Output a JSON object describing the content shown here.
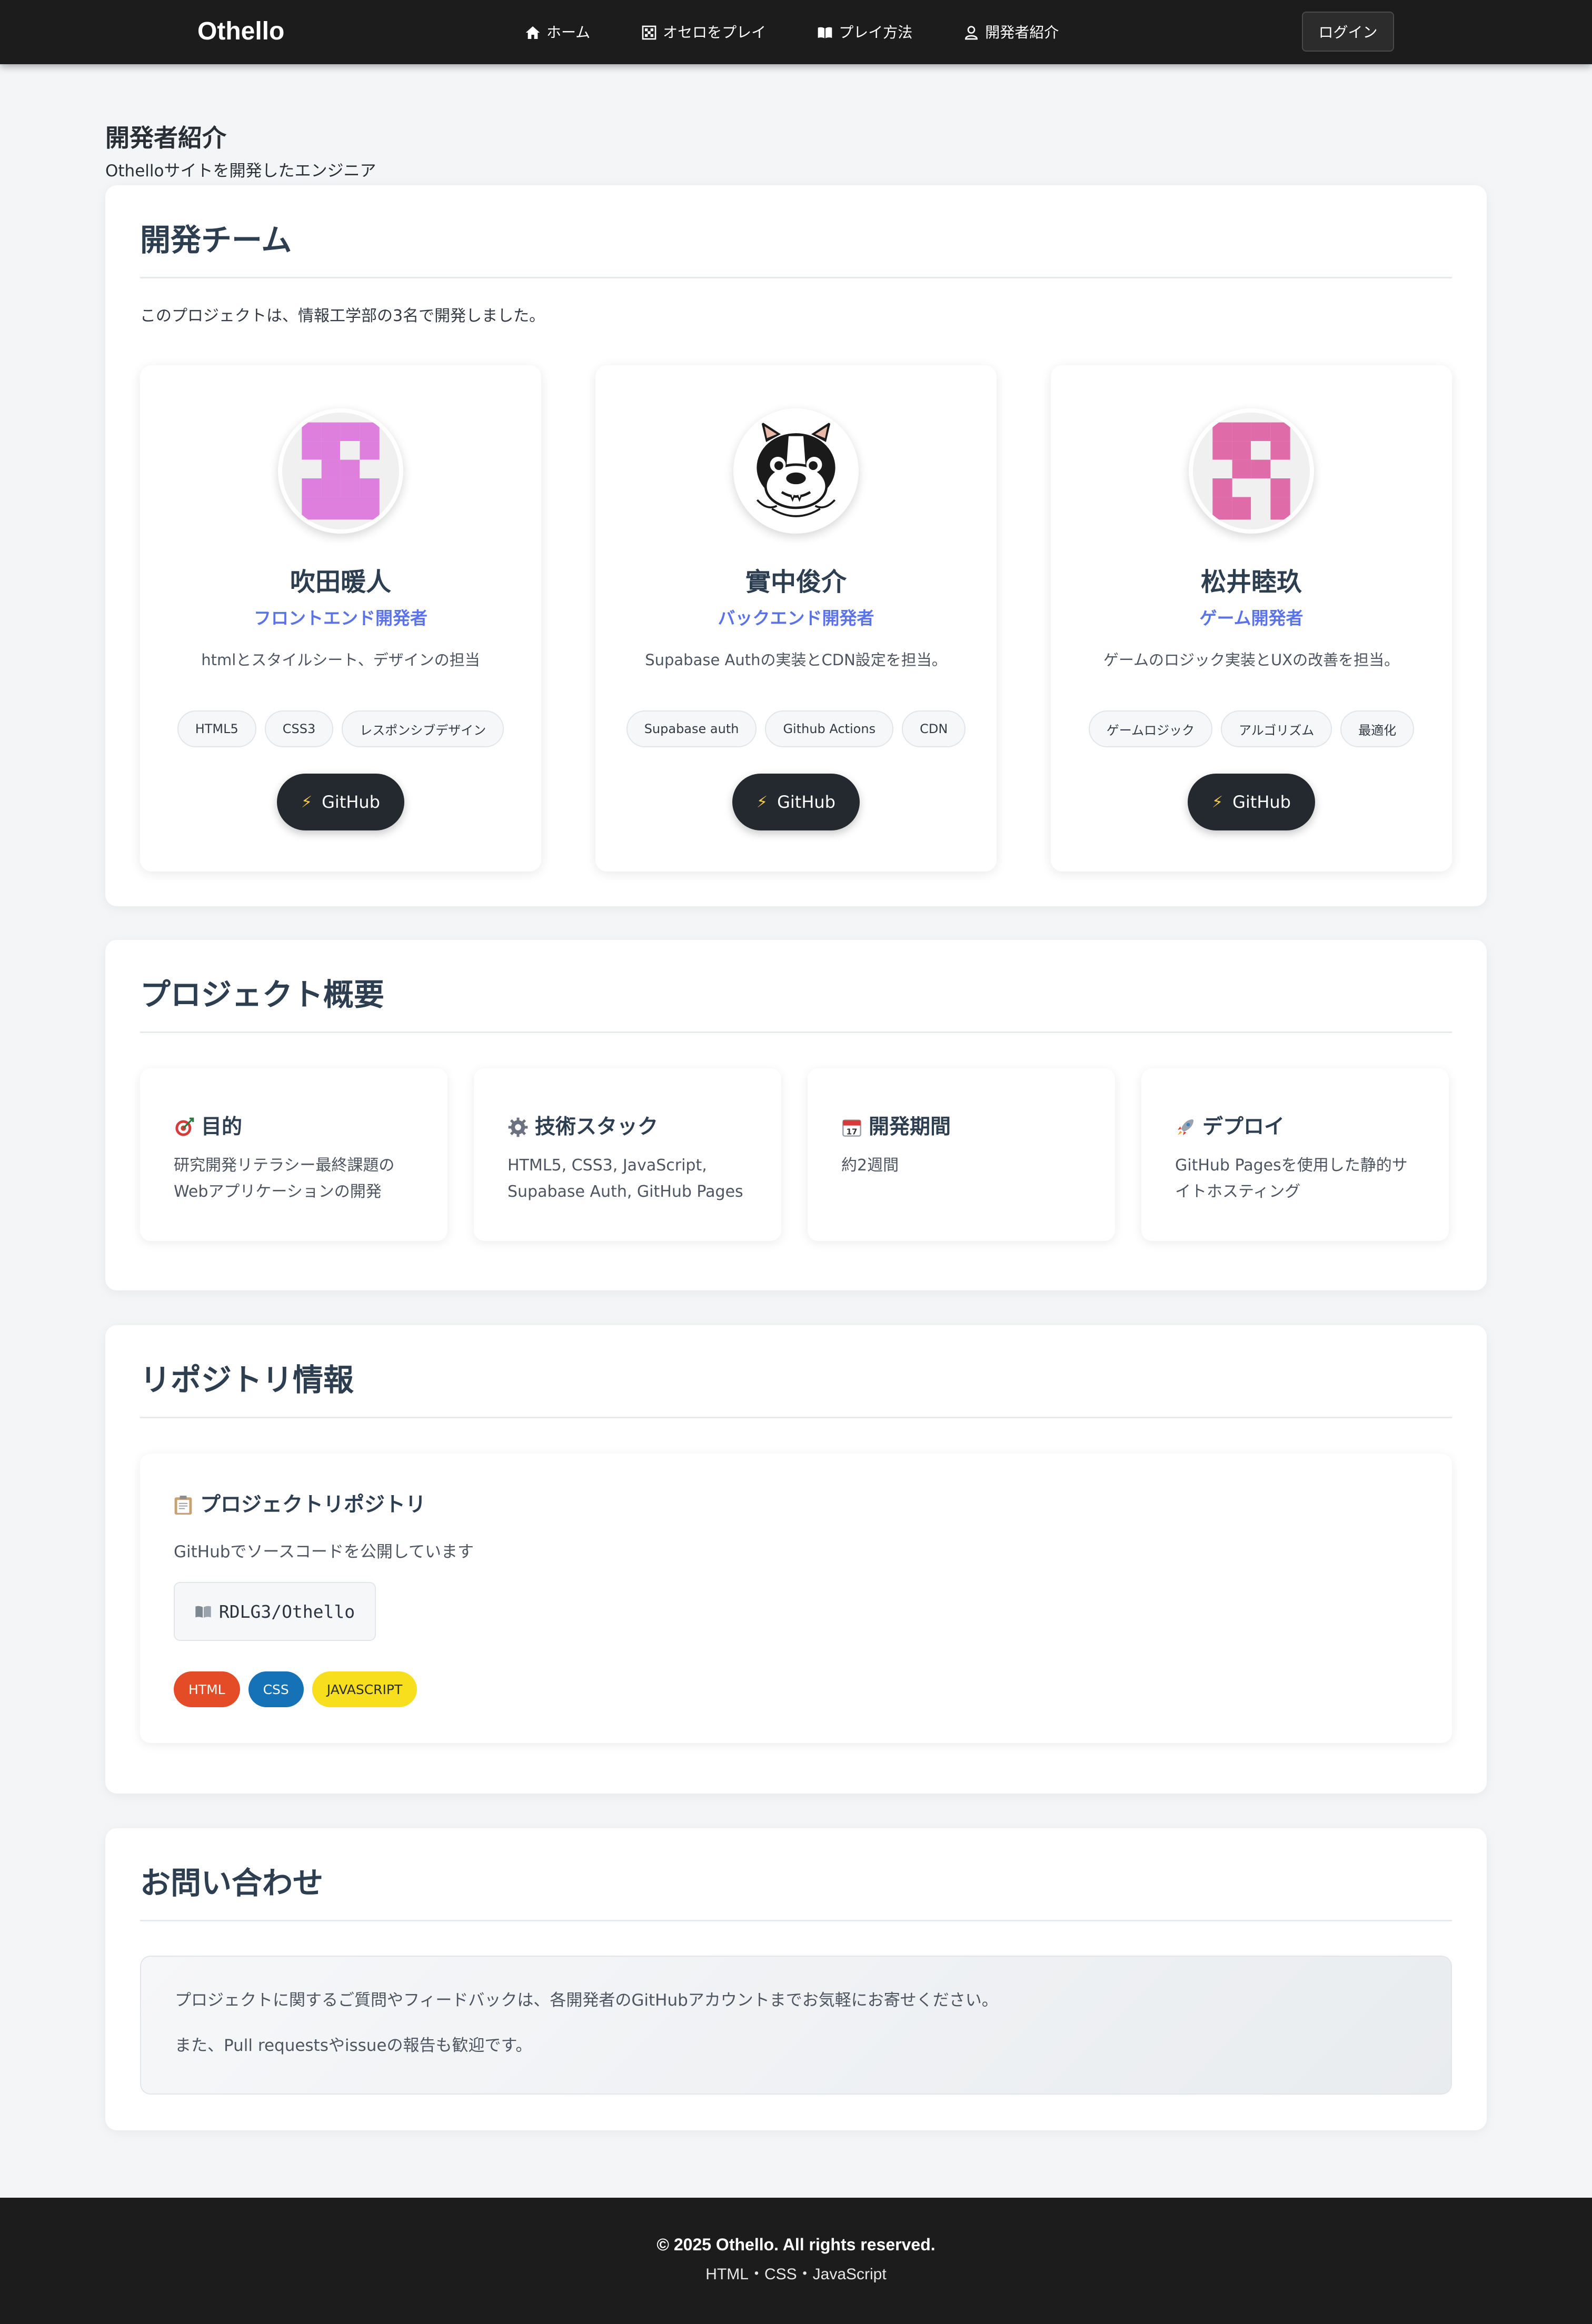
{
  "navbar": {
    "brand": "Othello",
    "items": [
      {
        "label": "ホーム",
        "icon": "home-icon"
      },
      {
        "label": "オセロをプレイ",
        "icon": "grid-icon"
      },
      {
        "label": "プレイ方法",
        "icon": "book-icon"
      },
      {
        "label": "開発者紹介",
        "icon": "user-icon"
      }
    ],
    "login_label": "ログイン"
  },
  "page": {
    "title": "開発者紹介",
    "subtitle": "Othelloサイトを開発したエンジニア"
  },
  "team": {
    "title": "開発チーム",
    "intro": "このプロジェクトは、情報工学部の3名で開発しました。",
    "members": [
      {
        "name": "吹田暖人",
        "role": "フロントエンド開発者",
        "description": "htmlとスタイルシート、デザインの担当",
        "skills": [
          "HTML5",
          "CSS3",
          "レスポンシブデザイン"
        ],
        "github_label": "GitHub",
        "avatar": "identicon-purple",
        "avatar_color": "#de7fde"
      },
      {
        "name": "實中俊介",
        "role": "バックエンド開発者",
        "description": "Supabase Authの実装とCDN設定を担当。",
        "skills": [
          "Supabase auth",
          "Github Actions",
          "CDN"
        ],
        "github_label": "GitHub",
        "avatar": "french-bulldog-illustration"
      },
      {
        "name": "松井睦玖",
        "role": "ゲーム開発者",
        "description": "ゲームのロジック実装とUXの改善を担当。",
        "skills": [
          "ゲームロジック",
          "アルゴリズム",
          "最適化"
        ],
        "github_label": "GitHub",
        "avatar": "identicon-pink",
        "avatar_color": "#df6ca8"
      }
    ]
  },
  "overview": {
    "title": "プロジェクト概要",
    "cards": [
      {
        "icon": "target-icon",
        "title": "目的",
        "body": "研究開発リテラシー最終課題のWebアプリケーションの開発"
      },
      {
        "icon": "gear-icon",
        "title": "技術スタック",
        "body": "HTML5, CSS3, JavaScript, Supabase Auth, GitHub Pages"
      },
      {
        "icon": "calendar-icon",
        "title": "開発期間",
        "body": "約2週間"
      },
      {
        "icon": "rocket-icon",
        "title": "デプロイ",
        "body": "GitHub Pagesを使用した静的サイトホスティング"
      }
    ]
  },
  "repository": {
    "title": "リポジトリ情報",
    "card_title": "プロジェクトリポジトリ",
    "description": "GitHubでソースコードを公開しています",
    "repo_name": "RDLG3/Othello",
    "languages": [
      {
        "label": "HTML",
        "bg": "#e34c26",
        "fg": "#ffffff"
      },
      {
        "label": "CSS",
        "bg": "#1572b6",
        "fg": "#ffffff"
      },
      {
        "label": "JAVASCRIPT",
        "bg": "#f7df1e",
        "fg": "#2c2c2c"
      }
    ]
  },
  "contact": {
    "title": "お問い合わせ",
    "line1": "プロジェクトに関するご質問やフィードバックは、各開発者のGitHubアカウントまでお気軽にお寄せください。",
    "line2": "また、Pull requestsやissueの報告も歓迎です。"
  },
  "footer": {
    "copyright": "© 2025 Othello. All rights reserved.",
    "tech": "HTML・CSS・JavaScript"
  },
  "colors": {
    "accent": "#5b73e8",
    "navbar_bg": "#1c1c1c",
    "page_bg": "#f4f5f7",
    "heading": "#2c3e50"
  }
}
